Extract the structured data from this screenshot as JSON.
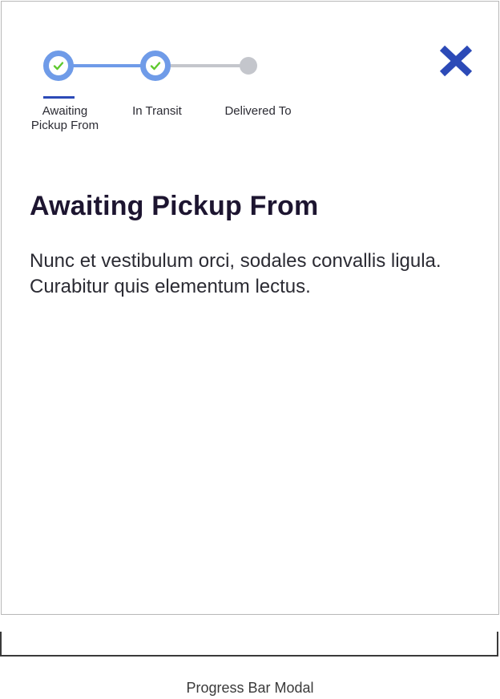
{
  "stepper": {
    "steps": [
      {
        "label": "Awaiting\nPickup From",
        "status": "complete"
      },
      {
        "label": "In Transit",
        "status": "complete"
      },
      {
        "label": "Delivered To",
        "status": "pending"
      }
    ],
    "active_index": 0
  },
  "close_icon": "close-icon",
  "content": {
    "heading": "Awaiting Pickup From",
    "body": "Nunc et vestibulum orci, sodales convallis ligula. Curabitur quis elementum lectus."
  },
  "caption": "Progress Bar Modal",
  "colors": {
    "track_done": "#6f9be8",
    "track_pending": "#c4c6cc",
    "check": "#5fc92e",
    "close": "#2c4ab7",
    "active_underline": "#2c4ab7",
    "heading": "#1d1530"
  }
}
